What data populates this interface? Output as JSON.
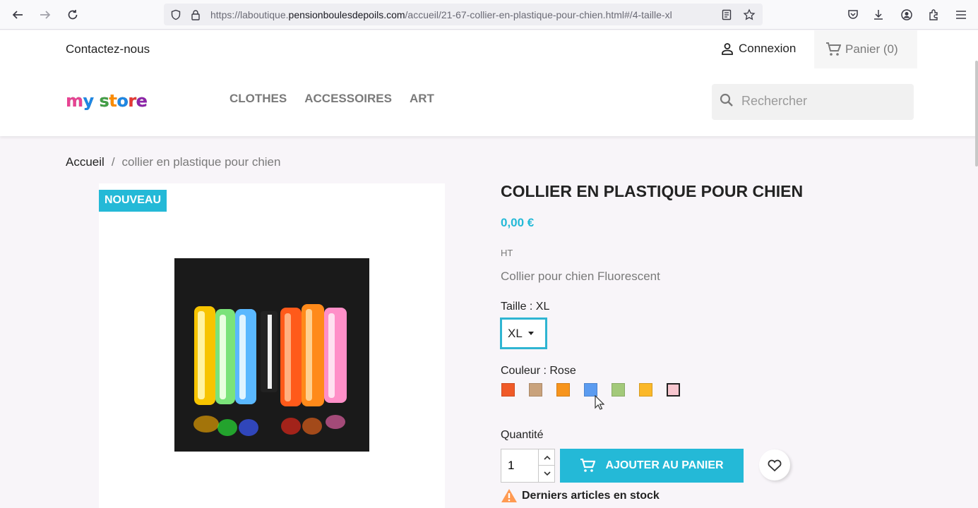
{
  "browser": {
    "url_prefix": "https://laboutique.",
    "url_domain": "pensionboulesdepoils.com",
    "url_path": "/accueil/21-67-collier-en-plastique-pour-chien.html#/4-taille-xl"
  },
  "header": {
    "contact": "Contactez-nous",
    "login": "Connexion",
    "cart": "Panier (0)",
    "logo_letters": [
      "m",
      "y",
      " ",
      "s",
      "t",
      "o",
      "r",
      "e"
    ],
    "logo_colors": [
      "#e84393",
      "#1e88e5",
      "#ffffff",
      "#43a047",
      "#fb8c00",
      "#1e88e5",
      "#e53935",
      "#8e24aa"
    ],
    "menu": [
      "CLOTHES",
      "ACCESSOIRES",
      "ART"
    ],
    "search_placeholder": "Rechercher"
  },
  "breadcrumb": {
    "home": "Accueil",
    "separator": "/",
    "current": "collier en plastique pour chien"
  },
  "product": {
    "badge": "NOUVEAU",
    "title": "COLLIER EN PLASTIQUE POUR CHIEN",
    "price": "0,00 €",
    "tax": "HT",
    "description": "Collier pour chien Fluorescent",
    "size_label": "Taille : XL",
    "size_value": "XL",
    "color_label": "Couleur : Rose",
    "swatches": [
      "#f05a28",
      "#c9a27c",
      "#f7941d",
      "#5b9bf0",
      "#a3c97a",
      "#fbb829",
      "#f7c6cf"
    ],
    "quantity_label": "Quantité",
    "quantity_value": "1",
    "add_to_cart": "AJOUTER AU PANIER",
    "stock_notice": "Derniers articles en stock"
  }
}
